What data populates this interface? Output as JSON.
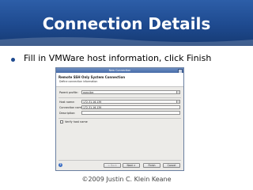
{
  "slide": {
    "title": "Connection Details",
    "bullet": "Fill in VMWare host information, click Finish",
    "footer": "©2009 Justin C. Klein Keane"
  },
  "dialog": {
    "window_title": "New Connection",
    "header_title": "Remote SSH Only System Connection",
    "header_subtitle": "Define connection information",
    "parent_profile_label": "Parent profile:",
    "parent_profile_value": "mercitre",
    "host_name_label": "Host name:",
    "host_name_value": "172.31.16.139",
    "connection_name_label": "Connection name:",
    "connection_name_value": "172.31.16.139",
    "description_label": "Description:",
    "description_value": "",
    "verify_label": "Verify host name",
    "verify_checked": false,
    "buttons": {
      "back": "< Back",
      "next": "Next >",
      "finish": "Finish",
      "cancel": "Cancel"
    }
  },
  "colors": {
    "title_band": "#1e4a8f",
    "title_text": "#ffffff",
    "dialog_titlebar": "#466ba8"
  }
}
